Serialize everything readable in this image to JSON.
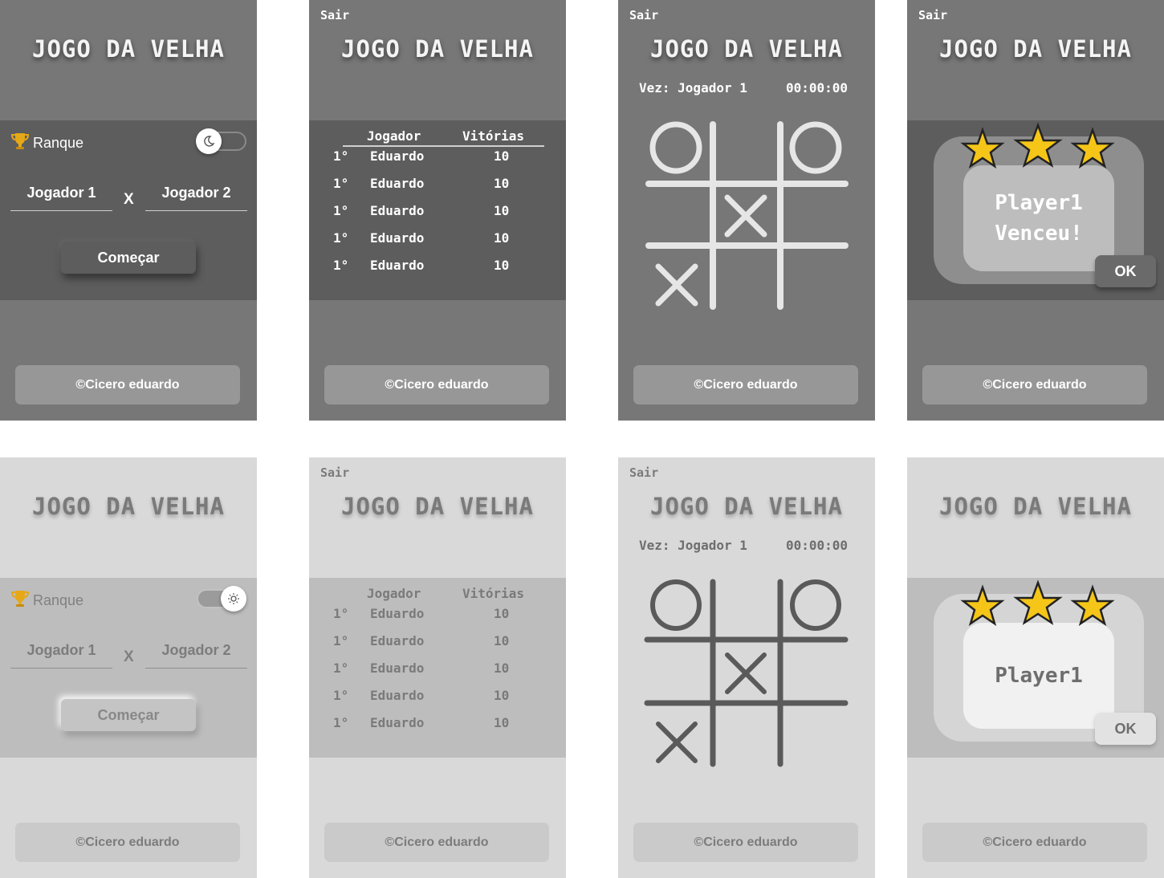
{
  "common": {
    "game_title": "JOGO DA VELHA",
    "exit_label": "Sair",
    "footer_text": "©Cicero eduardo"
  },
  "home": {
    "ranking_label": "Ranque",
    "player1_value": "Jogador 1",
    "player2_value": "Jogador 2",
    "versus": "X",
    "start_label": "Começar",
    "dark_toggle_icon": "moon-icon",
    "light_toggle_icon": "sun-icon",
    "trophy_color": "#e6a817"
  },
  "ranking": {
    "header_player": "Jogador",
    "header_wins": "Vitórias",
    "rows": [
      {
        "position": "1°",
        "name": "Eduardo",
        "wins": "10"
      },
      {
        "position": "1°",
        "name": "Eduardo",
        "wins": "10"
      },
      {
        "position": "1°",
        "name": "Eduardo",
        "wins": "10"
      },
      {
        "position": "1°",
        "name": "Eduardo",
        "wins": "10"
      },
      {
        "position": "1°",
        "name": "Eduardo",
        "wins": "10"
      }
    ]
  },
  "game": {
    "turn_text": "Vez: Jogador 1",
    "timer": "00:00:00",
    "cells": [
      "O",
      "",
      "O",
      "",
      "X",
      "",
      "X",
      "",
      ""
    ]
  },
  "win": {
    "dark_message_line1": "Player1",
    "dark_message_line2": "Venceu!",
    "light_message": "Player1",
    "ok_label": "OK",
    "star_count": 3,
    "star_color": "#f5c518"
  }
}
